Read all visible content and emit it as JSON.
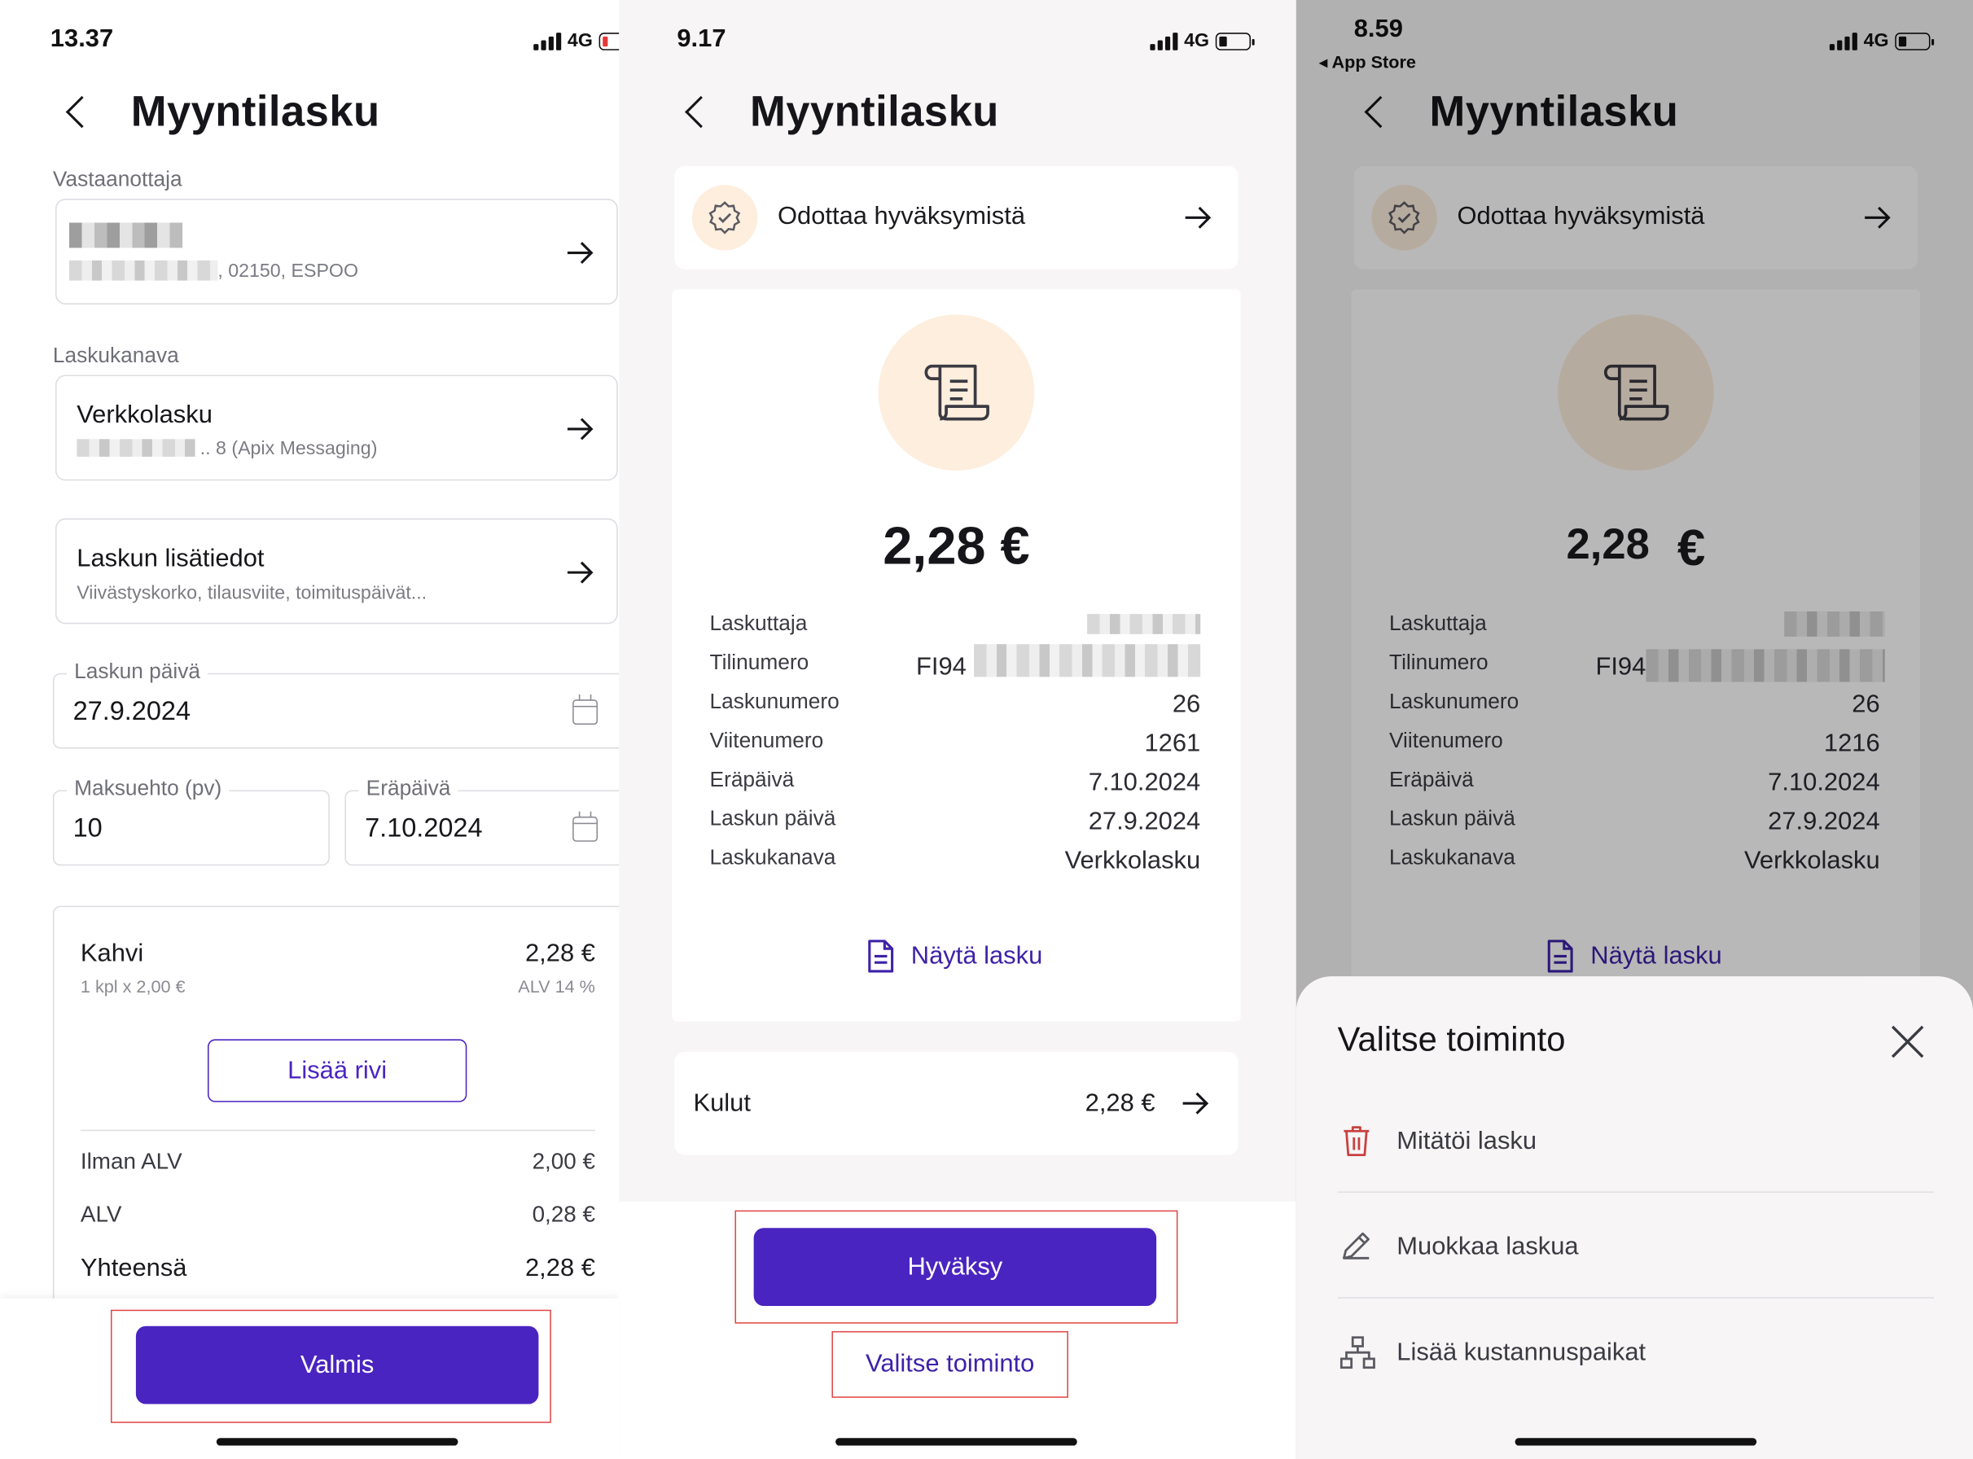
{
  "screens": [
    {
      "status": {
        "time": "13.37",
        "network": "4G"
      },
      "header": {
        "title": "Myyntilasku"
      },
      "recipient": {
        "label": "Vastaanottaja",
        "address_suffix": ", 02150, ESPOO"
      },
      "channel": {
        "label": "Laskukanava",
        "name": "Verkkolasku",
        "detail": ".. 8 (Apix Messaging)"
      },
      "extra": {
        "title": "Laskun lisätiedot",
        "subtitle": "Viivästyskorko, tilausviite, toimituspäivät..."
      },
      "invoice_date": {
        "label": "Laskun päivä",
        "value": "27.9.2024"
      },
      "payment_terms": {
        "label": "Maksuehto (pv)",
        "value": "10"
      },
      "due_date": {
        "label": "Eräpäivä",
        "value": "7.10.2024"
      },
      "line_item": {
        "name": "Kahvi",
        "qty": "1 kpl x 2,00 €",
        "total": "2,28 €",
        "vat": "ALV 14 %"
      },
      "add_row_label": "Lisää rivi",
      "totals": [
        {
          "label": "Ilman ALV",
          "value": "2,00 €"
        },
        {
          "label": "ALV",
          "value": "0,28 €"
        },
        {
          "label": "Yhteensä",
          "value": "2,28 €"
        }
      ],
      "done_label": "Valmis"
    },
    {
      "status": {
        "time": "9.17",
        "network": "4G"
      },
      "header": {
        "title": "Myyntilasku"
      },
      "approval": {
        "label": "Odottaa hyväksymistä"
      },
      "amount": "2,28 €",
      "details": [
        {
          "label": "Laskuttaja",
          "value": ""
        },
        {
          "label": "Tilinumero",
          "value": "FI94"
        },
        {
          "label": "Laskunumero",
          "value": "26"
        },
        {
          "label": "Viitenumero",
          "value": "1261"
        },
        {
          "label": "Eräpäivä",
          "value": "7.10.2024"
        },
        {
          "label": "Laskun päivä",
          "value": "27.9.2024"
        },
        {
          "label": "Laskukanava",
          "value": "Verkkolasku"
        }
      ],
      "show_invoice_label": "Näytä lasku",
      "costs": {
        "label": "Kulut",
        "value": "2,28 €"
      },
      "approve_label": "Hyväksy",
      "choose_action_label": "Valitse toiminto"
    },
    {
      "status": {
        "time": "8.59",
        "network": "4G",
        "back_app": "◂ App Store"
      },
      "header": {
        "title": "Myyntilasku"
      },
      "approval": {
        "label": "Odottaa hyväksymistä"
      },
      "amount_value": "2,28",
      "amount_currency": "€",
      "details": [
        {
          "label": "Laskuttaja",
          "value": ""
        },
        {
          "label": "Tilinumero",
          "value": "FI94"
        },
        {
          "label": "Laskunumero",
          "value": "26"
        },
        {
          "label": "Viitenumero",
          "value": "1216"
        },
        {
          "label": "Eräpäivä",
          "value": "7.10.2024"
        },
        {
          "label": "Laskun päivä",
          "value": "27.9.2024"
        },
        {
          "label": "Laskukanava",
          "value": "Verkkolasku"
        }
      ],
      "show_invoice_label": "Näytä lasku",
      "sheet": {
        "title": "Valitse toiminto",
        "items": [
          {
            "label": "Mitätöi lasku",
            "icon": "trash-icon"
          },
          {
            "label": "Muokkaa laskua",
            "icon": "pencil-icon"
          },
          {
            "label": "Lisää kustannuspaikat",
            "icon": "hierarchy-icon"
          }
        ]
      }
    }
  ],
  "colors": {
    "accent": "#4a24c0",
    "highlight_box": "#e04848",
    "icon_circle": "#fdeedd",
    "delete_red": "#c94040"
  }
}
